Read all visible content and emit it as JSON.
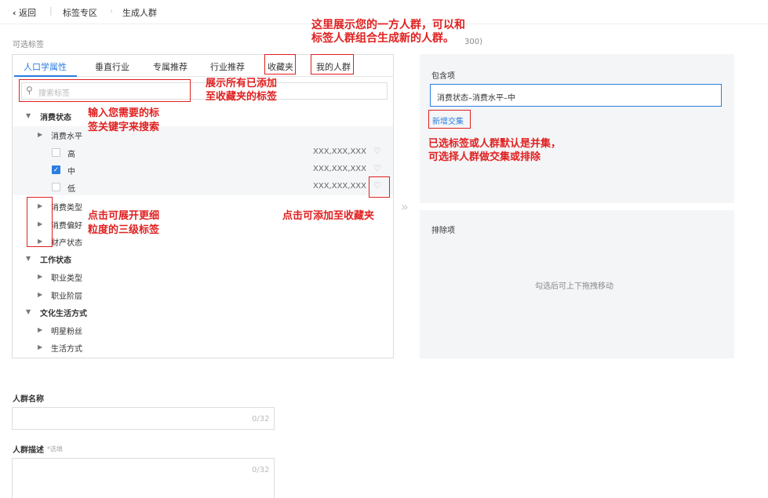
{
  "topbar": {
    "back_label": "返回",
    "crumbs": [
      "标签专区",
      "生成人群"
    ]
  },
  "section_title": "可选标签",
  "count_suffix": "300)",
  "tabs": [
    "人口学属性",
    "垂直行业",
    "专属推荐",
    "行业推荐",
    "收藏夹",
    "我的人群"
  ],
  "search": {
    "placeholder": "搜索标签"
  },
  "tree": {
    "consumption_status": "消费状态",
    "consumption_level": "消费水平",
    "options": [
      {
        "label": "高",
        "count": "XXX,XXX,XXX",
        "checked": false
      },
      {
        "label": "中",
        "count": "XXX,XXX,XXX",
        "checked": true
      },
      {
        "label": "低",
        "count": "XXX,XXX,XXX",
        "checked": false
      }
    ],
    "consumption_type": "消费类型",
    "consumption_pref": "消费偏好",
    "asset_status": "财产状态",
    "work_status": "工作状态",
    "job_type": "职业类型",
    "job_level": "职业阶层",
    "culture_lifestyle": "文化生活方式",
    "star_fans": "明星粉丝",
    "lifestyle": "生活方式"
  },
  "include": {
    "title": "包含项",
    "value": "消费状态–消费水平–中",
    "add_intersection": "新增交集"
  },
  "exclude": {
    "title": "排除项",
    "hint": "勾选后可上下拖拽移动"
  },
  "form": {
    "name_label": "人群名称",
    "name_counter": "0/32",
    "desc_label": "人群描述",
    "desc_optional": "*选填",
    "desc_counter": "0/32"
  },
  "annotations": {
    "first_party_1": "这里展示您的一方人群，可以和",
    "first_party_2": "标签人群组合生成新的人群。",
    "favorites_1": "展示所有已添加",
    "favorites_2": "至收藏夹的标签",
    "search_1": "输入您需要的标",
    "search_2": "签关键字来搜索",
    "union_1": "已选标签或人群默认是并集，",
    "union_2": "可选择人群做交集或排除",
    "add_fav": "点击可添加至收藏夹",
    "expand_1": "点击可展开更细",
    "expand_2": "粒度的三级标签"
  },
  "colors": {
    "accent": "#2b7de1",
    "annotation": "#e02020",
    "panel_bg": "#f4f5f7"
  }
}
